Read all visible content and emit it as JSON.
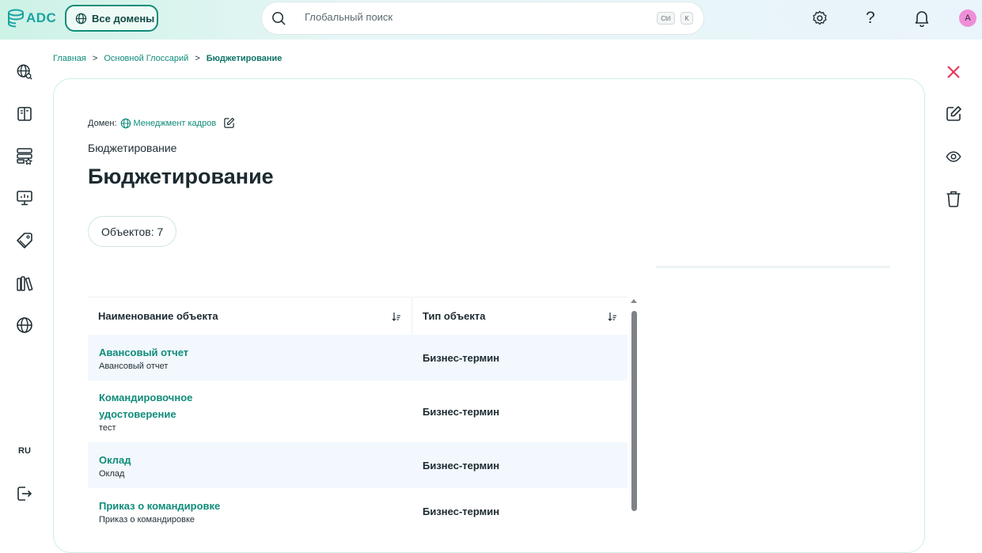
{
  "app": {
    "logo_text": "ADC"
  },
  "header": {
    "domains_button": "Все домены",
    "search": {
      "placeholder": "Глобальный поиск",
      "shortcut_key1": "Ctrl",
      "shortcut_key2": "K"
    },
    "avatar_initial": "A"
  },
  "sidebar": {
    "language": "RU"
  },
  "breadcrumb": {
    "items": [
      "Главная",
      "Основной Глоссарий",
      "Бюджетирование"
    ],
    "separator": ">"
  },
  "page": {
    "domain_label": "Домен:",
    "domain_value": "Менеджмент кадров",
    "subtitle": "Бюджетирование",
    "title": "Бюджетирование",
    "objects_count": "Объектов: 7"
  },
  "table": {
    "columns": [
      "Наименование объекта",
      "Тип объекта"
    ],
    "rows": [
      {
        "name": "Авансовый отчет",
        "desc": "Авансовый отчет",
        "type": "Бизнес-термин"
      },
      {
        "name": "Командировочное удостоверение",
        "desc": "тест",
        "type": "Бизнес-термин"
      },
      {
        "name": "Оклад",
        "desc": "Оклад",
        "type": "Бизнес-термин"
      },
      {
        "name": "Приказ о командировке",
        "desc": "Приказ о командировке",
        "type": "Бизнес-термин"
      }
    ]
  },
  "colors": {
    "accent": "#0f8c7a",
    "close": "#e5325b",
    "row_alt": "#f2f8fd"
  }
}
